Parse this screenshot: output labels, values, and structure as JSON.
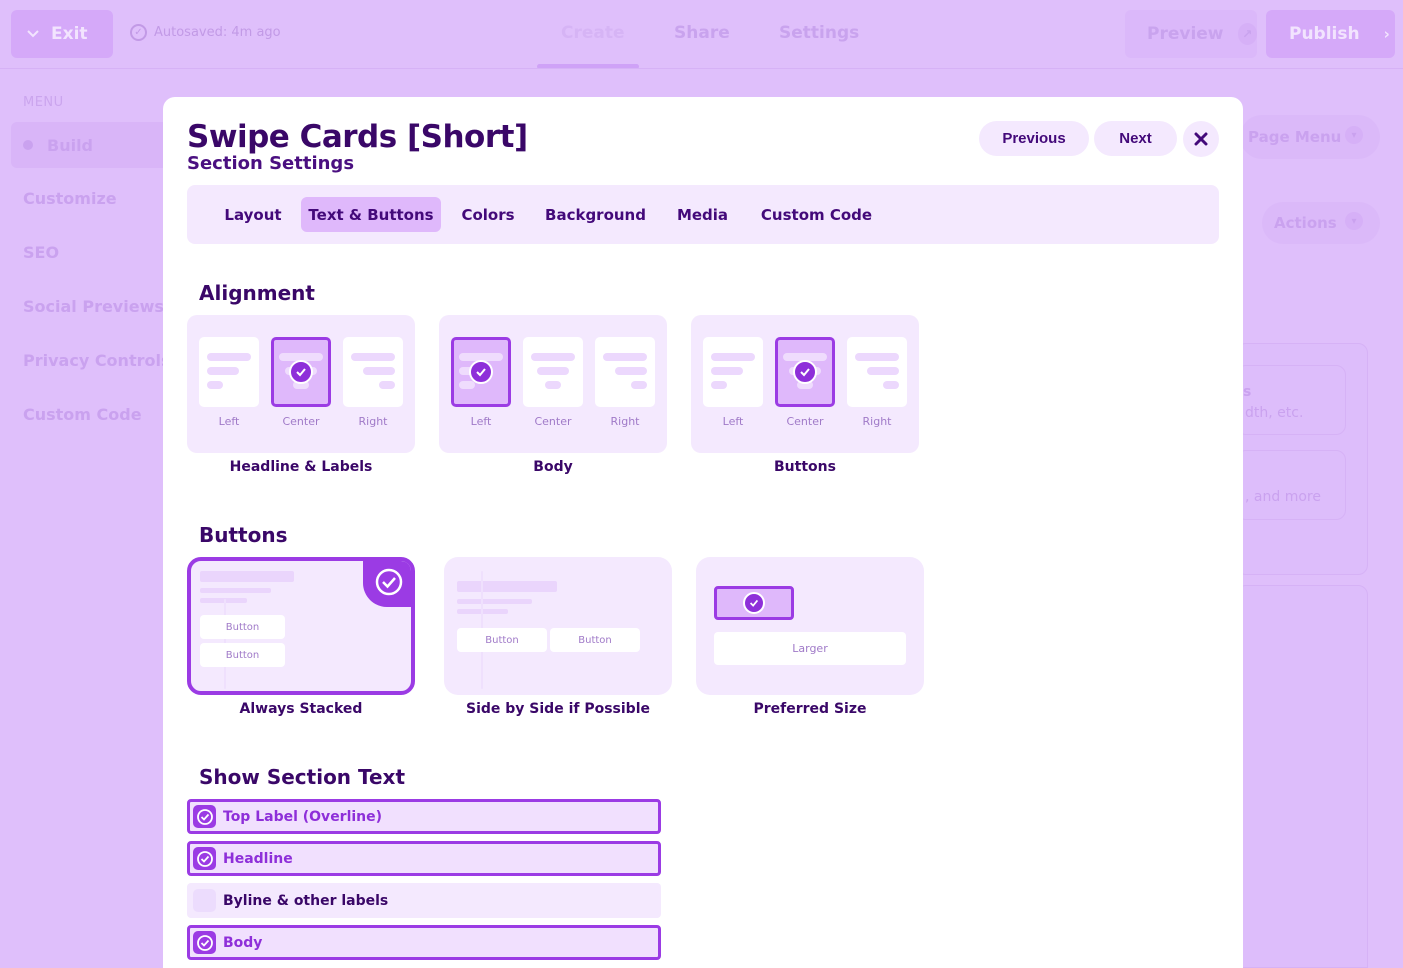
{
  "topbar": {
    "exit_label": "Exit",
    "autosave": "Autosaved: 4m ago",
    "tabs": [
      "Create",
      "Share",
      "Settings"
    ],
    "preview_label": "Preview",
    "publish_label": "Publish"
  },
  "sidebar": {
    "menu_label": "MENU",
    "items": [
      "Build",
      "Customize",
      "SEO",
      "Social Previews",
      "Privacy Controls",
      "Custom Code"
    ]
  },
  "right_panel": {
    "page_menu": "Page Menu",
    "actions": "Actions",
    "card1_fragment": "s",
    "card1_desc_fragment": "dth, etc.",
    "card2_desc_fragment": ", and more"
  },
  "modal": {
    "title": "Swipe Cards [Short]",
    "subtitle": "Section Settings",
    "previous_label": "Previous",
    "next_label": "Next",
    "tabs": [
      {
        "label": "Layout",
        "active": false
      },
      {
        "label": "Text & Buttons",
        "active": true
      },
      {
        "label": "Colors",
        "active": false
      },
      {
        "label": "Background",
        "active": false
      },
      {
        "label": "Media",
        "active": false
      },
      {
        "label": "Custom Code",
        "active": false
      }
    ]
  },
  "alignment": {
    "heading": "Alignment",
    "option_labels": [
      "Left",
      "Center",
      "Right"
    ],
    "groups": [
      {
        "name": "Headline & Labels",
        "selected": "Center"
      },
      {
        "name": "Body",
        "selected": "Left"
      },
      {
        "name": "Buttons",
        "selected": "Center"
      }
    ]
  },
  "buttons": {
    "heading": "Buttons",
    "button_word": "Button",
    "larger_word": "Larger",
    "options": [
      {
        "name": "Always Stacked",
        "selected": true
      },
      {
        "name": "Side by Side if Possible",
        "selected": false
      },
      {
        "name": "Preferred Size",
        "selected": false
      }
    ]
  },
  "section_text": {
    "heading": "Show Section Text",
    "items": [
      {
        "label": "Top Label (Overline)",
        "checked": true
      },
      {
        "label": "Headline",
        "checked": true
      },
      {
        "label": "Byline & other labels",
        "checked": false
      },
      {
        "label": "Body",
        "checked": true
      }
    ]
  },
  "colors": {
    "accent": "#9b3be4",
    "accent_light": "#dfb8fb",
    "panel": "#f4e9fe",
    "text_dark": "#3a0768",
    "backdrop": "#dfbffb"
  }
}
